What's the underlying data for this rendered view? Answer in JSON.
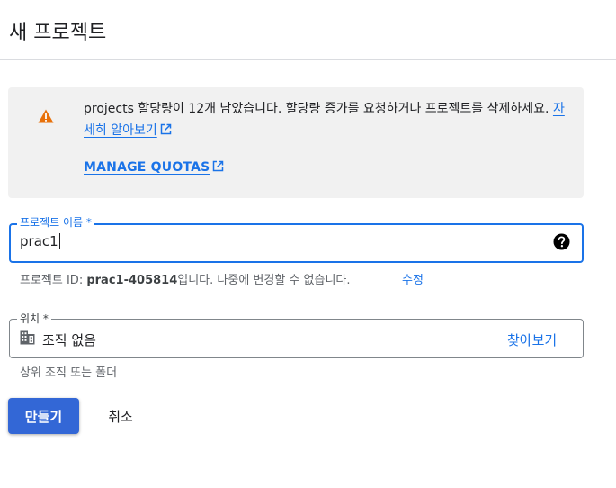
{
  "header": {
    "title": "새 프로젝트"
  },
  "quota_notice": {
    "message": "projects 할당량이 12개 남았습니다. 할당량 증가를 요청하거나 프로젝트를 삭제하세요.",
    "learn_more_label": "자세히 알아보기",
    "manage_quotas_label": "MANAGE QUOTAS",
    "icon": "warning-icon",
    "warning_color": "#e8710a"
  },
  "project_name_field": {
    "label": "프로젝트 이름 *",
    "value": "prac1",
    "help_icon": "help-icon"
  },
  "project_id_hint": {
    "prefix": "프로젝트 ID: ",
    "id": "prac1-405814",
    "suffix": "입니다. 나중에 변경할 수 없습니다.",
    "edit_label": "수정"
  },
  "location_field": {
    "label": "위치 *",
    "value": "조직 없음",
    "browse_label": "찾아보기",
    "hint": "상위 조직 또는 폴더",
    "icon": "organization-icon"
  },
  "actions": {
    "create_label": "만들기",
    "cancel_label": "취소"
  },
  "colors": {
    "accent": "#1a73e8",
    "button": "#3367d6",
    "notice_background": "#f1f1f1"
  }
}
